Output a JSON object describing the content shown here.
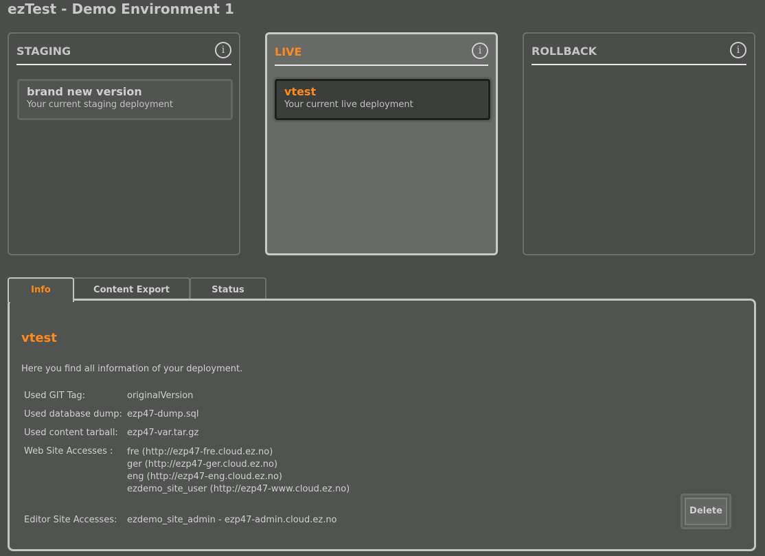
{
  "app": {
    "title": "ezTest - Demo Environment 1"
  },
  "columns": [
    {
      "title": "STAGING",
      "info": "i",
      "card": {
        "name": "brand new version",
        "desc": "Your current staging deployment"
      }
    },
    {
      "title": "LIVE",
      "info": "i",
      "card": {
        "name": "vtest",
        "desc": "Your current live deployment"
      }
    },
    {
      "title": "ROLLBACK",
      "info": "i"
    }
  ],
  "tabs": [
    "Info",
    "Content Export",
    "Status"
  ],
  "panel": {
    "title": "vtest",
    "intro": "Here you find all information of your deployment.",
    "git_label": "Used GIT Tag:",
    "git_value": "originalVersion",
    "db_label": "Used database dump:",
    "db_value": "ezp47-dump.sql",
    "tar_label": "Used content tarball:",
    "tar_value": "ezp47-var.tar.gz",
    "web_label": "Web Site Accesses :",
    "web_values": [
      "fre (http://ezp47-fre.cloud.ez.no)",
      "ger (http://ezp47-ger.cloud.ez.no)",
      "eng (http://ezp47-eng.cloud.ez.no)",
      "ezdemo_site_user (http://ezp47-www.cloud.ez.no)"
    ],
    "editor_label": "Editor Site Accesses:",
    "editor_value": "ezdemo_site_admin - ezp47-admin.cloud.ez.no",
    "delete_label": "Delete"
  },
  "colors": {
    "accent": "#ff8a1c",
    "background": "#4b4d4b"
  }
}
